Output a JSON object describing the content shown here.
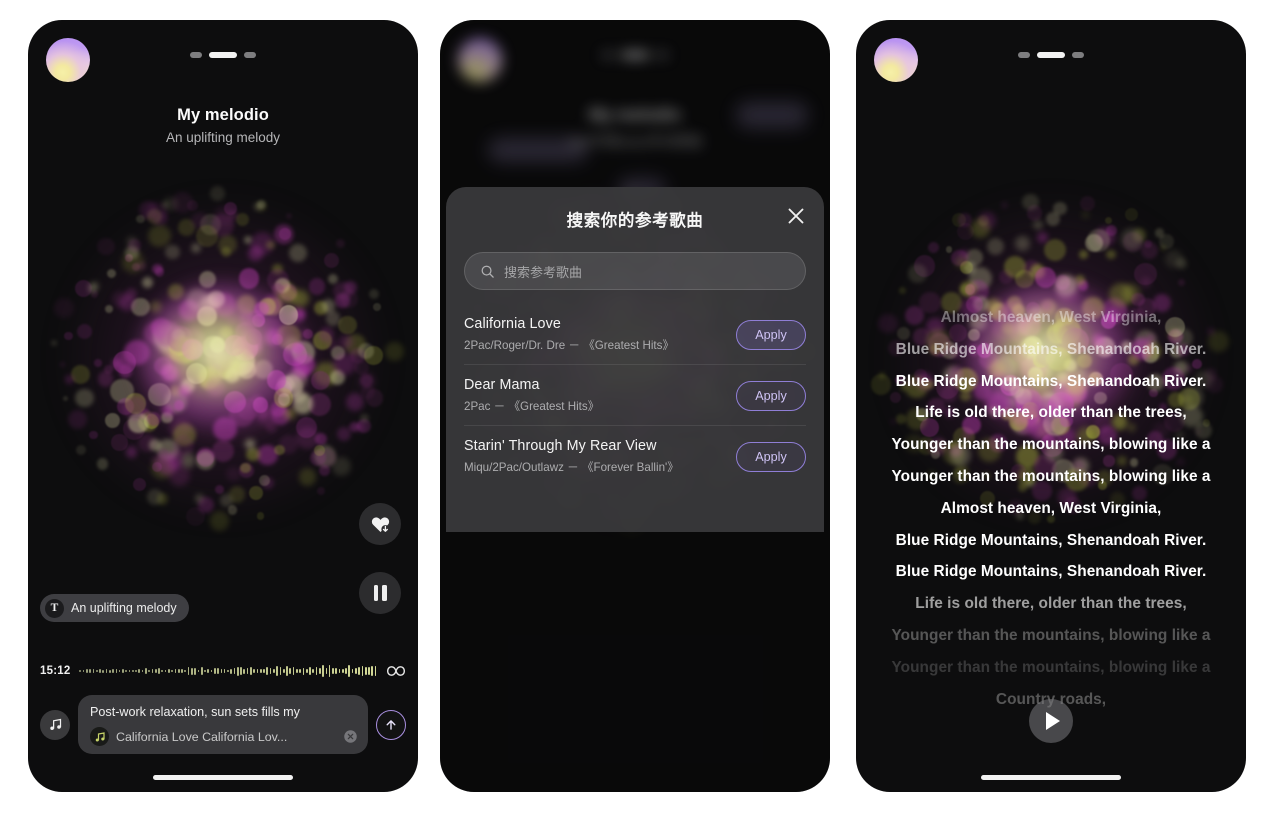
{
  "app": {
    "background": "#ffffff",
    "panel_bg": "#0d0d0e",
    "accent_purple": "#8f7ed6",
    "accent_text": "#cfc3f5",
    "particle_colors": [
      "#c43fb8",
      "#b8c23f",
      "#7b2f70",
      "#e8e8b0"
    ]
  },
  "panel1": {
    "name": "generation-screen",
    "avatar": "user-avatar",
    "page_dots": {
      "count": 3,
      "active_index": 1
    },
    "title": "My melodio",
    "subtitle": "An uplifting melody",
    "like_icon": "heart-download-icon",
    "pause_icon": "pause-icon",
    "prompt_chip": {
      "icon": "text-prompt-icon",
      "label": "An uplifting melody"
    },
    "waveform": {
      "time": "15:12",
      "loop_icon": "infinity-loop-icon"
    },
    "composer": {
      "music_note_icon": "music-note-icon",
      "prompt_text": "Post-work relaxation, sun sets fills my",
      "ref_song_icon": "song-badge-icon",
      "ref_song": "California Love California Lov...",
      "clear_icon": "close-circle-icon",
      "send_icon": "send-up-arrow-icon"
    }
  },
  "panel2": {
    "name": "reference-song-search-screen",
    "backdrop": {
      "title": "My melodio",
      "subtitle": "rap/中国/pop/多动感曲",
      "ghost_apply": "Apply",
      "ghost_tag1": "ringthusic",
      "ghost_tag2": "Rap"
    },
    "modal": {
      "title": "搜索你的参考歌曲",
      "close_icon": "close-icon",
      "search": {
        "icon": "search-icon",
        "placeholder": "搜索参考歌曲",
        "value": ""
      },
      "songs": [
        {
          "title": "California Love",
          "meta": "2Pac/Roger/Dr. Dre －  《Greatest Hits》",
          "apply_label": "Apply",
          "selected": true
        },
        {
          "title": "Dear Mama",
          "meta": "2Pac －  《Greatest Hits》",
          "apply_label": "Apply",
          "selected": false
        },
        {
          "title": "Starin' Through My Rear View",
          "meta": "Miqu/2Pac/Outlawz －  《Forever Ballin'》",
          "apply_label": "Apply",
          "selected": false
        }
      ]
    }
  },
  "panel3": {
    "name": "lyrics-playback-screen",
    "avatar": "user-avatar",
    "page_dots": {
      "count": 3,
      "active_index": 1
    },
    "play_icon": "play-icon",
    "lyrics": [
      "Almost heaven, West Virginia,",
      "Blue Ridge Mountains, Shenandoah River.",
      "Blue Ridge Mountains, Shenandoah River.",
      "Life is old there, older than the trees,",
      "Younger than the mountains, blowing like a",
      "Younger than the mountains, blowing like a",
      "Almost heaven, West Virginia,",
      "Blue Ridge Mountains, Shenandoah River.",
      "Blue Ridge Mountains, Shenandoah River.",
      "Life is old there, older than the trees,",
      "Younger than the mountains, blowing like a",
      "Younger than the mountains, blowing like a",
      "Country roads,"
    ]
  }
}
